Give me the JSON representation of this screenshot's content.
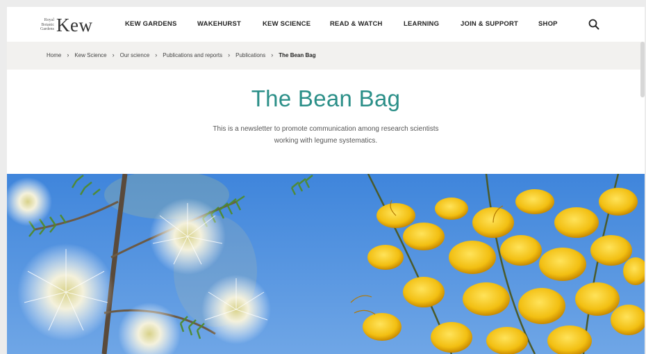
{
  "logo": {
    "line1": "Royal",
    "line2": "Botanic",
    "line3": "Gardens",
    "name": "Kew"
  },
  "nav": [
    {
      "label": "KEW GARDENS"
    },
    {
      "label": "WAKEHURST"
    },
    {
      "label": "KEW SCIENCE"
    },
    {
      "label": "READ & WATCH"
    },
    {
      "label": "LEARNING"
    },
    {
      "label": "JOIN & SUPPORT"
    },
    {
      "label": "SHOP"
    }
  ],
  "search_icon": "search-icon",
  "breadcrumb": [
    {
      "label": "Home"
    },
    {
      "label": "Kew Science"
    },
    {
      "label": "Our science"
    },
    {
      "label": "Publications and reports"
    },
    {
      "label": "Publications"
    },
    {
      "label": "The Bean Bag"
    }
  ],
  "page": {
    "title": "The Bean Bag",
    "description_line1": "This is a newsletter to promote communication among research scientists",
    "description_line2": "working with legume systematics."
  },
  "colors": {
    "accent": "#2b8f88",
    "sky": "#4f8fe0",
    "flower_yellow": "#f2c21a",
    "flower_white": "#f5f3e6",
    "leaf": "#4f8a2e"
  },
  "hero": {
    "image": "legume-flowers-photo"
  }
}
